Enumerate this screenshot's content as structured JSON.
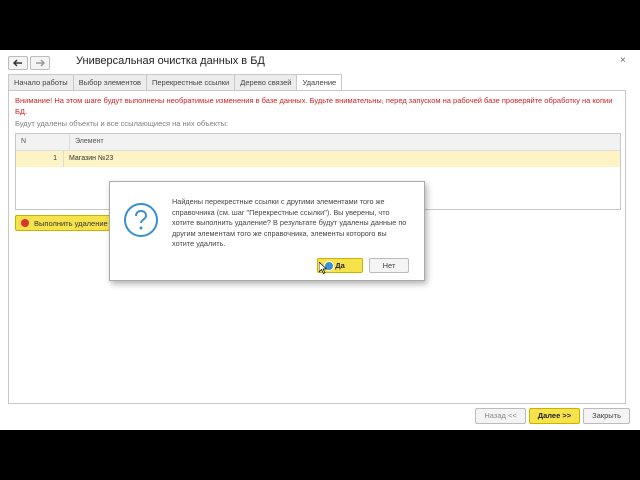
{
  "window": {
    "title": "Универсальная очистка данных в БД",
    "close_symbol": "×"
  },
  "nav": {
    "back_icon": "arrow-left-icon",
    "forward_icon": "arrow-right-icon"
  },
  "tabs": [
    {
      "label": "Начало работы"
    },
    {
      "label": "Выбор элементов"
    },
    {
      "label": "Перекрестные ссылки"
    },
    {
      "label": "Дерево связей"
    },
    {
      "label": "Удаление"
    }
  ],
  "active_tab": "Удаление",
  "warning": "Внимание! На этом шаге будут выполнены необратимые изменения в базе данных. Будьте внимательны, перед запуском на рабочей базе проверяйте обработку на копии БД.",
  "info": "Будут удалены объекты и все ссылающиеся на них объекты:",
  "grid": {
    "columns": [
      "N",
      "Элемент"
    ],
    "rows": [
      {
        "n": "1",
        "element": "Магазин №23"
      }
    ]
  },
  "execute_button": "Выполнить удаление",
  "footer": {
    "back": "Назад <<",
    "next": "Далее >>",
    "close": "Закрыть"
  },
  "dialog": {
    "icon": "question-icon",
    "message": "Найдены перекрестные ссылки с другими элементами того же справочника (см. шаг \"Перекрестные ссылки\"). Вы уверены, что хотите выполнить удаление? В результате будут удалены данные по другим элементам того же справочника, элементы которого вы хотите удалить.",
    "yes": "Да",
    "no": "Нет"
  },
  "colors": {
    "accent": "#f6e34b",
    "warning": "#d42020",
    "selected_row": "#fdf3c5",
    "icon_blue": "#3a8fd1"
  }
}
